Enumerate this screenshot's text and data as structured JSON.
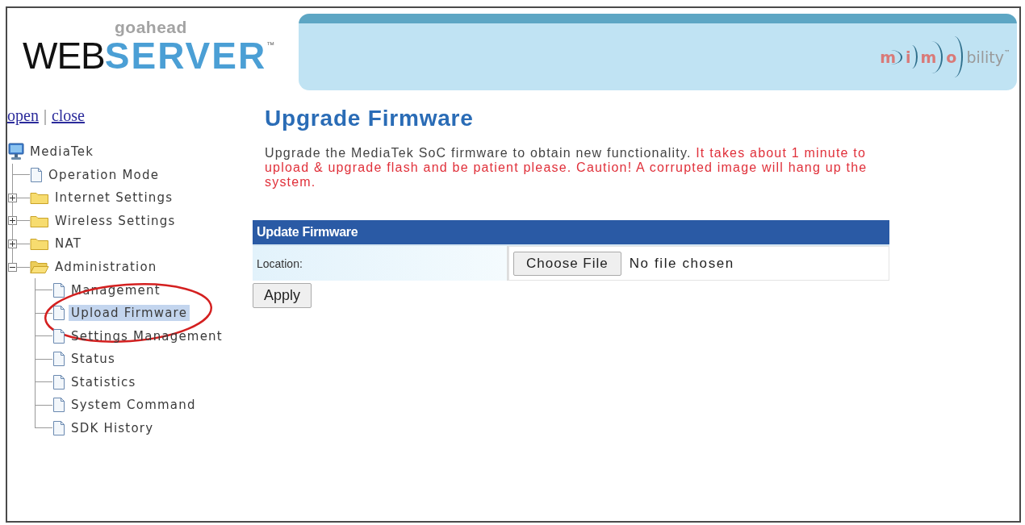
{
  "header": {
    "logo": {
      "subtitle": "goahead",
      "wordmark": [
        "WEB",
        "SERVER"
      ],
      "trademark": "™"
    },
    "banner": {
      "partner_logo": {
        "letters": [
          "m",
          "i",
          "m",
          "o"
        ],
        "suffix": "bility",
        "trademark": "™"
      }
    }
  },
  "sidebar": {
    "links": [
      "open",
      "close"
    ],
    "separator": "|",
    "tree": {
      "label": "MediaTek",
      "kind": "root",
      "selected": false,
      "circled": false,
      "children": [
        {
          "label": "Operation Mode",
          "kind": "page",
          "selected": false,
          "circled": false
        },
        {
          "label": "Internet Settings",
          "kind": "folder",
          "expanded": false,
          "selected": false,
          "circled": false
        },
        {
          "label": "Wireless Settings",
          "kind": "folder",
          "expanded": false,
          "selected": false,
          "circled": false
        },
        {
          "label": "NAT",
          "kind": "folder",
          "expanded": false,
          "selected": false,
          "circled": false
        },
        {
          "label": "Administration",
          "kind": "folder",
          "expanded": true,
          "selected": false,
          "circled": false,
          "children": [
            {
              "label": "Management",
              "kind": "page",
              "selected": false,
              "circled": false
            },
            {
              "label": "Upload Firmware",
              "kind": "page",
              "selected": true,
              "circled": true
            },
            {
              "label": "Settings Management",
              "kind": "page",
              "selected": false,
              "circled": false
            },
            {
              "label": "Status",
              "kind": "page",
              "selected": false,
              "circled": false
            },
            {
              "label": "Statistics",
              "kind": "page",
              "selected": false,
              "circled": false
            },
            {
              "label": "System Command",
              "kind": "page",
              "selected": false,
              "circled": false
            },
            {
              "label": "SDK History",
              "kind": "page",
              "selected": false,
              "circled": false
            }
          ]
        }
      ]
    }
  },
  "main": {
    "title": "Upgrade Firmware",
    "description": [
      {
        "kind": "info",
        "text": "Upgrade the MediaTek SoC firmware to obtain new functionality."
      },
      {
        "kind": "warning",
        "text": "It takes about 1 minute to upload & upgrade flash and be patient please. Caution! A corrupted image will hang up the system."
      }
    ],
    "form": {
      "heading": "Update Firmware",
      "rows": [
        {
          "label": "Location:",
          "kind": "file",
          "button": "Choose File",
          "status": "No file chosen"
        }
      ]
    },
    "buttons": [
      "Apply"
    ]
  }
}
